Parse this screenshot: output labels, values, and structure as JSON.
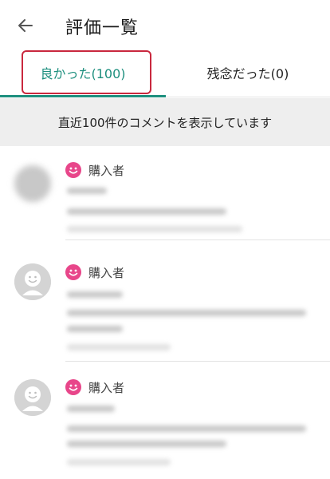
{
  "header": {
    "back_icon": "arrow-left-icon",
    "title": "評価一覧"
  },
  "tabs": [
    {
      "label": "良かった(100)",
      "selected": true
    },
    {
      "label": "残念だった(0)",
      "selected": false
    }
  ],
  "accent_color": "#1d8f7e",
  "highlight_color": "#c9283e",
  "notice": "直近100件のコメントを表示しています",
  "reviews": [
    {
      "role": "購入者",
      "rating_icon": "smile-icon"
    },
    {
      "role": "購入者",
      "rating_icon": "smile-icon"
    },
    {
      "role": "購入者",
      "rating_icon": "smile-icon"
    }
  ]
}
